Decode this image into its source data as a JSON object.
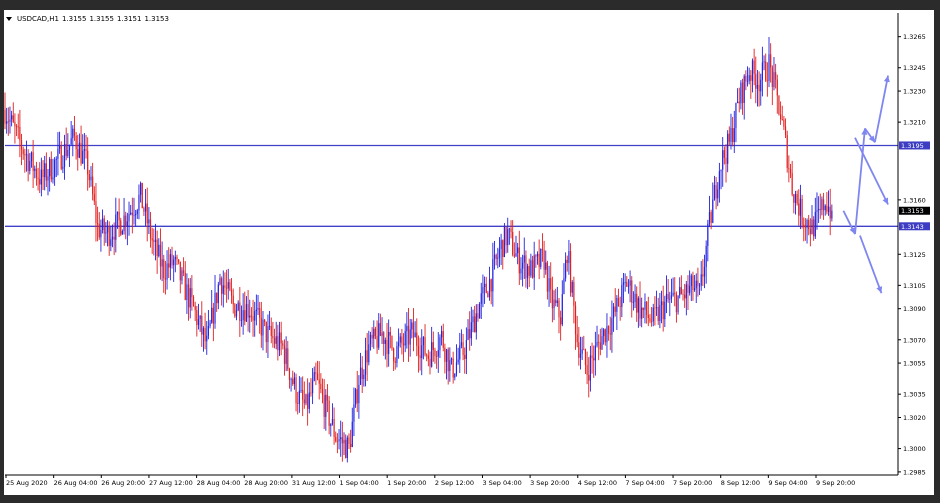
{
  "window": {
    "symbol_tf": "USDCAD,H1",
    "ohlc": [
      "1.3155",
      "1.3155",
      "1.3151",
      "1.3153"
    ]
  },
  "colors": {
    "bull": "#2323e0",
    "bear": "#e02020",
    "hline": "#4040c8",
    "arrow": "#7f86f0",
    "current_label_bg": "#000000",
    "level_label_bg": "#3d3dc4",
    "panel_bg": "#ffffff",
    "frame_bg": "#2b2b2b"
  },
  "chart_data": {
    "type": "candlestick",
    "symbol": "USDCAD",
    "timeframe": "H1",
    "ylim": [
      1.2983,
      1.3277
    ],
    "y_ticks": [
      "1.3265",
      "1.3245",
      "1.3230",
      "1.3210",
      "1.3160",
      "1.3125",
      "1.3105",
      "1.3090",
      "1.3070",
      "1.3055",
      "1.3035",
      "1.3020",
      "1.3000",
      "1.2985"
    ],
    "x_tick_labels": [
      "25 Aug 2020",
      "26 Aug 04:00",
      "26 Aug 20:00",
      "27 Aug 12:00",
      "28 Aug 04:00",
      "28 Aug 20:00",
      "31 Aug 12:00",
      "1 Sep 04:00",
      "1 Sep 20:00",
      "2 Sep 12:00",
      "3 Sep 04:00",
      "3 Sep 20:00",
      "4 Sep 12:00",
      "7 Sep 04:00",
      "7 Sep 20:00",
      "8 Sep 12:00",
      "9 Sep 04:00",
      "9 Sep 20:00"
    ],
    "horizontal_levels": [
      {
        "value": 1.3195,
        "label": "1.3195"
      },
      {
        "value": 1.3143,
        "label": "1.3143"
      }
    ],
    "current_price": {
      "value": 1.3153,
      "label": "1.3153"
    },
    "price_path": [
      [
        0,
        1.3218
      ],
      [
        12,
        1.319
      ],
      [
        22,
        1.3173
      ],
      [
        32,
        1.3186
      ],
      [
        42,
        1.32
      ],
      [
        50,
        1.3181
      ],
      [
        56,
        1.3142
      ],
      [
        62,
        1.3138
      ],
      [
        72,
        1.3148
      ],
      [
        82,
        1.3162
      ],
      [
        90,
        1.313
      ],
      [
        96,
        1.3115
      ],
      [
        102,
        1.312
      ],
      [
        108,
        1.3105
      ],
      [
        114,
        1.309
      ],
      [
        122,
        1.3066
      ],
      [
        130,
        1.311
      ],
      [
        138,
        1.3092
      ],
      [
        148,
        1.309
      ],
      [
        158,
        1.3074
      ],
      [
        168,
        1.3065
      ],
      [
        176,
        1.3036
      ],
      [
        182,
        1.3026
      ],
      [
        188,
        1.3044
      ],
      [
        194,
        1.3026
      ],
      [
        200,
        1.3008
      ],
      [
        208,
        1.3
      ],
      [
        214,
        1.3045
      ],
      [
        220,
        1.3065
      ],
      [
        228,
        1.3074
      ],
      [
        236,
        1.3062
      ],
      [
        246,
        1.3074
      ],
      [
        256,
        1.306
      ],
      [
        264,
        1.3072
      ],
      [
        270,
        1.305
      ],
      [
        278,
        1.3064
      ],
      [
        286,
        1.309
      ],
      [
        294,
        1.311
      ],
      [
        300,
        1.313
      ],
      [
        304,
        1.3138
      ],
      [
        310,
        1.3122
      ],
      [
        318,
        1.3115
      ],
      [
        326,
        1.3122
      ],
      [
        330,
        1.3095
      ],
      [
        336,
        1.3085
      ],
      [
        340,
        1.3128
      ],
      [
        346,
        1.307
      ],
      [
        352,
        1.305
      ],
      [
        360,
        1.307
      ],
      [
        368,
        1.3085
      ],
      [
        376,
        1.3107
      ],
      [
        384,
        1.309
      ],
      [
        392,
        1.3082
      ],
      [
        400,
        1.3094
      ],
      [
        410,
        1.3098
      ],
      [
        416,
        1.3104
      ],
      [
        420,
        1.3098
      ],
      [
        426,
        1.3144
      ],
      [
        432,
        1.3182
      ],
      [
        438,
        1.3196
      ],
      [
        444,
        1.3225
      ],
      [
        450,
        1.3243
      ],
      [
        456,
        1.3237
      ],
      [
        462,
        1.3247
      ],
      [
        468,
        1.322
      ],
      [
        472,
        1.3196
      ],
      [
        476,
        1.3168
      ],
      [
        482,
        1.315
      ],
      [
        488,
        1.3142
      ],
      [
        492,
        1.3148
      ],
      [
        496,
        1.316
      ],
      [
        500,
        1.3152
      ]
    ],
    "projection_arrows": [
      {
        "from": [
          507,
          1.3153
        ],
        "to": [
          514,
          1.3138
        ]
      },
      {
        "from": [
          514,
          1.3138
        ],
        "to": [
          520,
          1.3206
        ]
      },
      {
        "from": [
          520,
          1.3206
        ],
        "to": [
          526,
          1.3197
        ]
      },
      {
        "from": [
          526,
          1.3197
        ],
        "to": [
          534,
          1.324
        ]
      },
      {
        "from": [
          514,
          1.32
        ],
        "to": [
          534,
          1.3157
        ]
      },
      {
        "from": [
          517,
          1.3137
        ],
        "to": [
          530,
          1.31
        ]
      }
    ]
  }
}
